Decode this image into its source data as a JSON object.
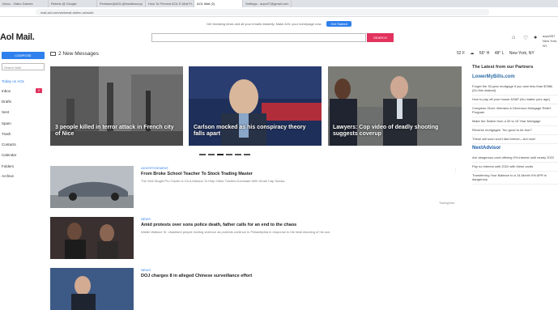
{
  "browser": {
    "tabs": [
      "Inbox - Video Games",
      "Rebels @ Google",
      "Firebase@AOL@insidescoop",
      "How To Prevent AOL E-Mail Fr...",
      "AOL Mail (2)",
      "Settings - aopv07@gmail.com"
    ],
    "active_tab": 4,
    "url": "mail.aol.com/webmail-std/en-us/suite"
  },
  "promo": {
    "text": "Get breaking news and all your emails instantly. Make AOL your homepage now.",
    "button": "Get Started"
  },
  "header": {
    "logo_text": "Aol",
    "logo_suffix": "Mail.",
    "search_button": "SEARCH",
    "user_name": "aopv057",
    "user_location": "New York, NY"
  },
  "sidebar": {
    "compose": "COMPOSE",
    "search_placeholder": "Search Mail",
    "items": [
      {
        "label": "Today on AOL",
        "badge": ""
      },
      {
        "label": "Inbox",
        "badge": "2"
      },
      {
        "label": "Drafts",
        "badge": ""
      },
      {
        "label": "Sent",
        "badge": ""
      },
      {
        "label": "Spam",
        "badge": ""
      },
      {
        "label": "Trash",
        "badge": ""
      },
      {
        "label": "Contacts",
        "badge": ""
      },
      {
        "label": "Calendar",
        "badge": ""
      },
      {
        "label": "Folders",
        "badge": ""
      },
      {
        "label": "Archive",
        "badge": ""
      }
    ]
  },
  "main": {
    "new_messages": "2 New Messages",
    "weather": {
      "temp_now": "52 F",
      "high": "56° H",
      "low": "48° L",
      "location": "New York, NY"
    },
    "hero_cards": [
      {
        "caption": "3 people killed in terror attack in French city of Nice"
      },
      {
        "caption": "Carlson mocked as his conspiracy theory falls apart"
      },
      {
        "caption": "Lawyers: Cop video of deadly shooting suggests coverup"
      }
    ],
    "stories": [
      {
        "label": "ADVERTISEMENT",
        "title": "From Broke School Teacher To Stock Trading Master",
        "desc": "The Self-Taught Pro Trader Is On A Mission To Help Other Traders Dominate With Small Cap Stocks.",
        "source": "TradingView"
      },
      {
        "label": "NEWS",
        "title": "Amid protests over sons police death, father calls for an end to the chaos",
        "desc": "Walter Wallace Sr. chastised people inciting violence as protests continue in Philadelphia in response to the fatal shooting of his son.",
        "source": ""
      },
      {
        "label": "NEWS",
        "title": "DOJ charges 8 in alleged Chinese surveillance effort",
        "desc": "",
        "source": ""
      }
    ]
  },
  "right_panel": {
    "heading": "The Latest from our Partners",
    "brand1": "LowerMyBills.com",
    "brand1_items": [
      "Forget the 30-year mortgage if you owe less than $766k (Do this instead)",
      "How to pay off your house ASAP (No matter your age)",
      "Congress Gives Veterans A Generous Mortgage Relief Program"
    ],
    "brand2": "NextAdvisor",
    "mid_items": [
      "Make the Switch from a 30 to 15 Year Mortgage",
      "Reverse mortgages: Too good to be true?",
      "These will soon won't last forever—Act now!"
    ],
    "brand2_items": [
      "Are dangerous card offering 0% interest until nearly 2022",
      "Pay no interest until 2022 with these cards",
      "Transferring Your Balance to a 14-Month 0% APR is dangerous"
    ]
  }
}
